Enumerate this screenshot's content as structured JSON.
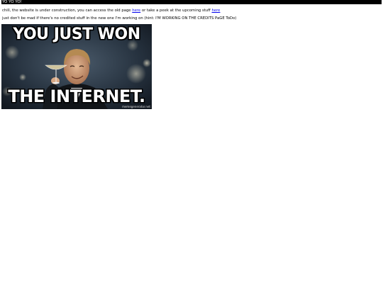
{
  "header": {
    "title": "YO YO YO!"
  },
  "intro": {
    "text_before_first_link": "chill, the website is under construction, you can access the old page ",
    "first_link": "here",
    "text_between_links": " or take a peek at the upcoming stuff ",
    "second_link": "here"
  },
  "note": {
    "text": "just don't be mad if there's no credited stuff in the new one I'm working on (hint: I'M WORKING ON THE CREDITS PaGE ToDo)"
  },
  "meme": {
    "top_text": "YOU JUST WON",
    "bottom_text": "THE INTERNET.",
    "watermark": "memegenerator.net"
  },
  "colors": {
    "header_bg": "#000000",
    "header_text": "#ffffff",
    "link": "#0000ee",
    "page_bg": "#ffffff"
  }
}
